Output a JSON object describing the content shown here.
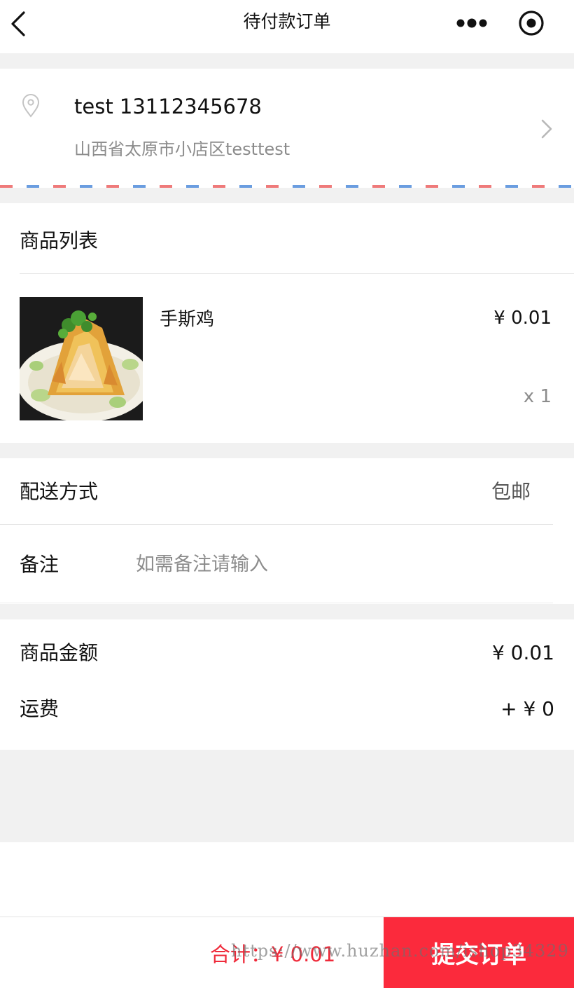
{
  "nav": {
    "title": "待付款订单"
  },
  "address": {
    "name_phone": "test 13112345678",
    "detail": "山西省太原市小店区testtest"
  },
  "goods": {
    "header": "商品列表",
    "items": [
      {
        "name": "手斯鸡",
        "price": "¥ 0.01",
        "quantity": "x 1"
      }
    ]
  },
  "delivery": {
    "label": "配送方式",
    "value": "包邮"
  },
  "note": {
    "label": "备注",
    "placeholder": "如需备注请输入"
  },
  "summary": {
    "goods_amount_label": "商品金额",
    "goods_amount_value": "¥ 0.01",
    "freight_label": "运费",
    "freight_value": "+ ¥ 0"
  },
  "footer": {
    "total": "合计：¥ 0.01",
    "submit_label": "提交订单"
  },
  "watermark": "https://www.huzhan.com/ishop34329",
  "colors": {
    "accent": "#fb2a3c",
    "total_text": "#ef2a3a",
    "background_gap": "#f1f1f1"
  }
}
